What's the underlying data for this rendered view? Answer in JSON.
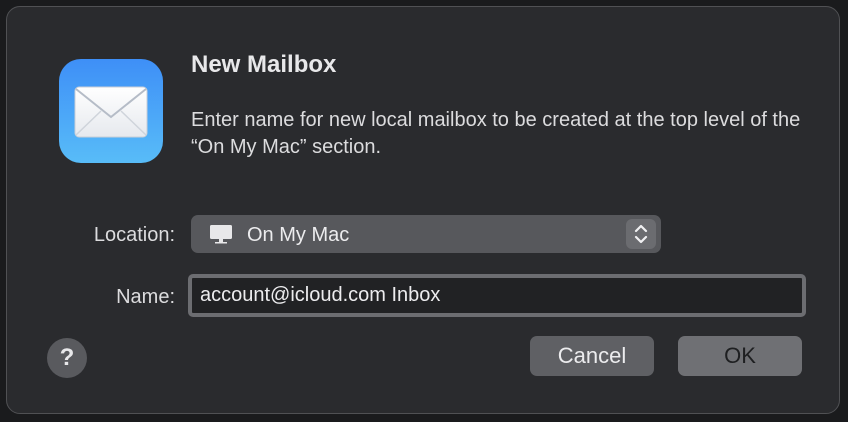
{
  "dialog": {
    "title": "New Mailbox",
    "description": "Enter name for new local mailbox to be created at the top level of the “On My Mac” section.",
    "app_icon": "mail-envelope-icon"
  },
  "location": {
    "label": "Location:",
    "selected": "On My Mac",
    "icon": "monitor-icon"
  },
  "name": {
    "label": "Name:",
    "value": "account@icloud.com Inbox"
  },
  "buttons": {
    "help": "?",
    "cancel": "Cancel",
    "ok": "OK"
  },
  "colors": {
    "dialog_bg": "#2a2b2e",
    "icon_gradient_top": "#3e8ff7",
    "icon_gradient_bottom": "#58bcf8"
  }
}
